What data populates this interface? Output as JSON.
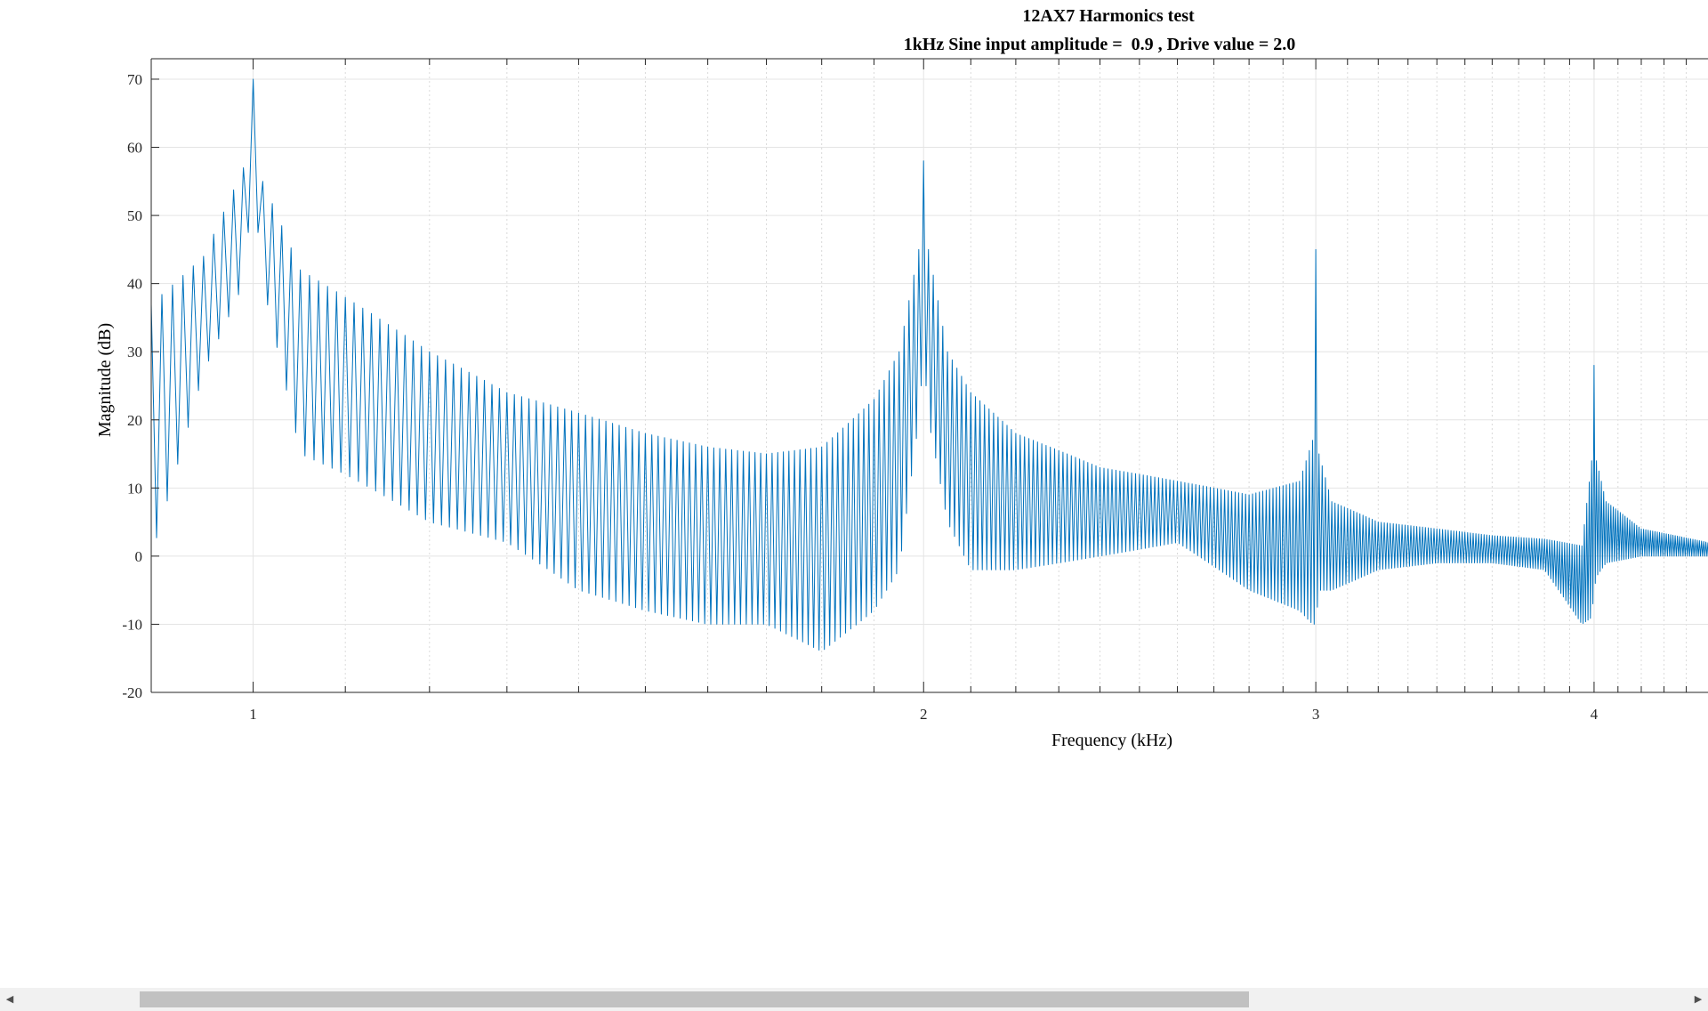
{
  "chart_data": {
    "type": "line",
    "title": "12AX7 Harmonics test",
    "subtitle": "1kHz Sine input amplitude =  0.9 , Drive value = 2.0",
    "xlabel": "Frequency (kHz)",
    "ylabel": "Magnitude (dB)",
    "x_scale": "log",
    "xlim": [
      0.9,
      4.5
    ],
    "ylim": [
      -20,
      73
    ],
    "x_ticks": [
      1,
      2,
      3,
      4
    ],
    "x_tick_labels": [
      "1",
      "2",
      "3",
      "4"
    ],
    "y_ticks": [
      -20,
      -10,
      0,
      10,
      20,
      30,
      40,
      50,
      60,
      70
    ],
    "y_tick_labels": [
      "-20",
      "-10",
      "0",
      "10",
      "20",
      "30",
      "40",
      "50",
      "60",
      "70"
    ],
    "grid": true,
    "minor_grid": true,
    "line_color": "#0072bd",
    "series": [
      {
        "envelope_x": [
          0.9,
          0.95,
          0.99,
          1.0,
          1.01,
          1.05,
          1.1,
          1.2,
          1.3,
          1.4,
          1.5,
          1.6,
          1.7,
          1.8,
          1.9,
          1.95,
          1.99,
          2.0,
          2.01,
          2.05,
          2.1,
          2.2,
          2.4,
          2.6,
          2.8,
          2.95,
          2.99,
          3.0,
          3.01,
          3.05,
          3.2,
          3.4,
          3.6,
          3.8,
          3.95,
          3.99,
          4.0,
          4.01,
          4.05,
          4.2,
          4.5
        ],
        "envelope_max": [
          37,
          44,
          57,
          70,
          55,
          42,
          38,
          30,
          24,
          21,
          18,
          16,
          15,
          16,
          23,
          30,
          45,
          58,
          45,
          30,
          24,
          18,
          13,
          11,
          9,
          11,
          17,
          45,
          15,
          8,
          5,
          4,
          3,
          2.5,
          1.5,
          14,
          28,
          14,
          8,
          4,
          2
        ],
        "envelope_min": [
          0,
          27,
          40,
          55,
          40,
          15,
          12,
          5,
          2,
          -5,
          -8,
          -10,
          -10,
          -14,
          -8,
          -2,
          20,
          30,
          20,
          5,
          -2,
          -2,
          0,
          2,
          -5,
          -8,
          -10,
          -10,
          -5,
          -5,
          -2,
          -1,
          -1,
          -2,
          -10,
          -9,
          -5,
          -3,
          -1,
          0,
          0
        ],
        "notch_spacing_khz": 0.01
      }
    ]
  },
  "scrollbar": {
    "left_arrow": "◀",
    "right_arrow": "▶"
  }
}
